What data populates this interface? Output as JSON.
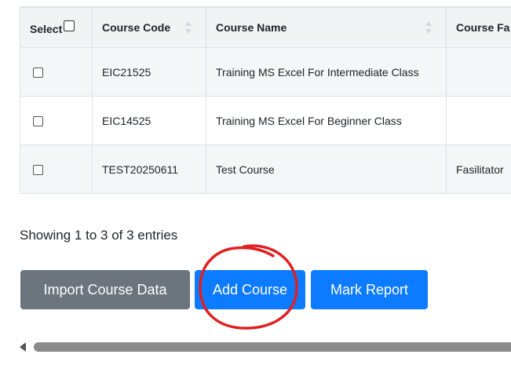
{
  "table": {
    "headers": {
      "select": "Select",
      "course_code": "Course Code",
      "course_name": "Course Name",
      "course_fa": "Course Fa"
    },
    "rows": [
      {
        "code": "EIC21525",
        "name": "Training MS Excel For Intermediate Class",
        "facilitator": ""
      },
      {
        "code": "EIC14525",
        "name": "Training MS Excel For Beginner Class",
        "facilitator": ""
      },
      {
        "code": "TEST20250611",
        "name": "Test Course",
        "facilitator": "Fasilitator"
      }
    ]
  },
  "info": {
    "text": "Showing 1 to 3 of 3 entries"
  },
  "buttons": {
    "import": "Import Course Data",
    "add": "Add Course",
    "mark": "Mark Report"
  },
  "colors": {
    "primary": "#0d7bff",
    "secondary": "#6c757d",
    "annotation": "#e02020"
  }
}
